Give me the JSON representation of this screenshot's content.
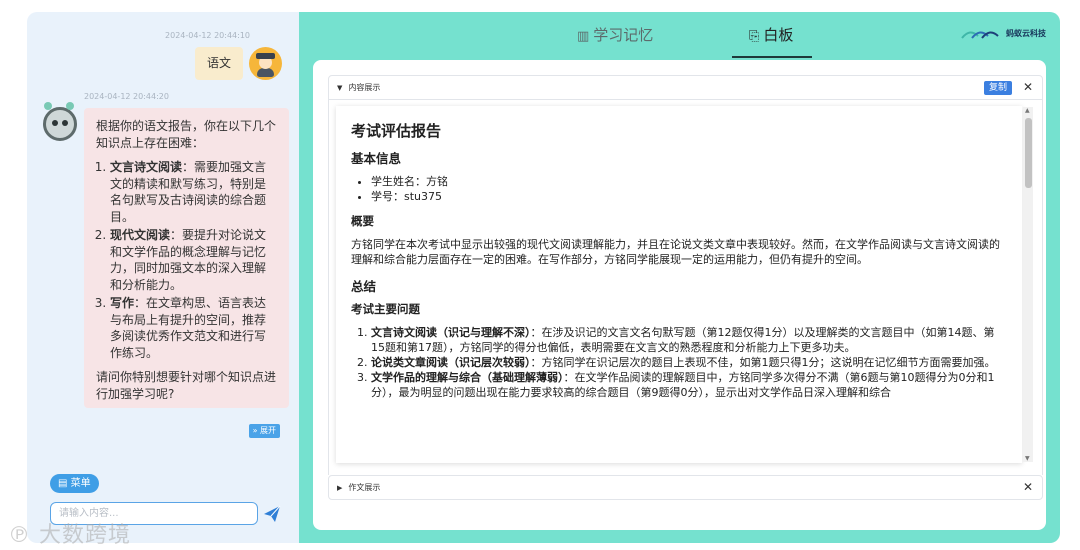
{
  "chat": {
    "user_timestamp": "2024-04-12 20:44:10",
    "user_message": "语文",
    "bot_timestamp": "2024-04-12 20:44:20",
    "bot_intro": "根据你的语文报告，你在以下几个知识点上存在困难：",
    "bot_items": [
      {
        "title": "文言诗文阅读",
        "text": "：需要加强文言文的精读和默写练习，特别是名句默写及古诗阅读的综合题目。"
      },
      {
        "title": "现代文阅读",
        "text": "：要提升对论说文和文学作品的概念理解与记忆力，同时加强文本的深入理解和分析能力。"
      },
      {
        "title": "写作",
        "text": "：在文章构思、语言表达与布局上有提升的空间，推荐多阅读优秀作文范文和进行写作练习。"
      }
    ],
    "bot_outro": "请问你特别想要针对哪个知识点进行加强学习呢?",
    "expand_label": "» 展开",
    "menu_label": "菜单",
    "input_placeholder": "请输入内容...",
    "watermark": "大数跨境"
  },
  "tabs": [
    {
      "label": "学习记忆",
      "icon": "book-icon",
      "active": false
    },
    {
      "label": "白板",
      "icon": "whiteboard-icon",
      "active": true
    }
  ],
  "logo": {
    "text": "蚂蚁云科技"
  },
  "board": {
    "section1_title": "内容展示",
    "copy_label": "复制",
    "section2_title": "作文展示",
    "report": {
      "title": "考试评估报告",
      "basic_info_heading": "基本信息",
      "basic_info": [
        "学生姓名：方铭",
        "学号：stu375"
      ],
      "overview_heading": "概要",
      "overview": "方铭同学在本次考试中显示出较强的现代文阅读理解能力，并且在论说文类文章中表现较好。然而，在文学作品阅读与文言诗文阅读的理解和综合能力层面存在一定的困难。在写作部分，方铭同学能展现一定的运用能力，但仍有提升的空间。",
      "summary_heading": "总结",
      "issues_heading": "考试主要问题",
      "issues": [
        {
          "title": "文言诗文阅读（识记与理解不深）",
          "text": "：在涉及识记的文言文名句默写题（第12题仅得1分）以及理解类的文言题目中（如第14题、第15题和第17题），方铭同学的得分也偏低，表明需要在文言文的熟悉程度和分析能力上下更多功夫。"
        },
        {
          "title": "论说类文章阅读（识记层次较弱）",
          "text": "：方铭同学在识记层次的题目上表现不佳，如第1题只得1分；这说明在记忆细节方面需要加强。"
        },
        {
          "title": "文学作品的理解与综合（基础理解薄弱）",
          "text": "：在文学作品阅读的理解题目中，方铭同学多次得分不满（第6题与第10题得分为0分和1分），最为明显的问题出现在能力要求较高的综合题目（第9题得0分），显示出对文学作品日深入理解和综合"
        }
      ]
    }
  },
  "colors": {
    "panel_left": "#e9f2fb",
    "panel_right": "#75e1cf",
    "accent_blue": "#3f9ee6",
    "bot_bubble": "#f7e4e6",
    "user_bubble": "#f9eccd"
  }
}
